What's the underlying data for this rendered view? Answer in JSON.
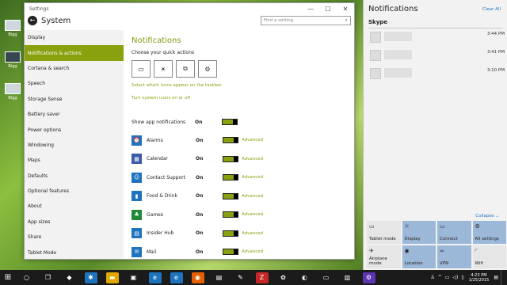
{
  "desktop": {
    "icons": [
      {
        "label": "Bigg",
        "icon": "thumbnail"
      },
      {
        "label": "Bigg",
        "icon": "thumbnail-dark"
      },
      {
        "label": "Bigg",
        "icon": "thumbnail"
      }
    ]
  },
  "window": {
    "title": "Settings",
    "controls": {
      "minimize": "—",
      "maximize": "☐",
      "close": "✕"
    },
    "header_title": "System",
    "search_placeholder": "Find a setting"
  },
  "sidebar": {
    "items": [
      {
        "label": "Display"
      },
      {
        "label": "Notifications & actions",
        "active": true
      },
      {
        "label": "Cortana & search"
      },
      {
        "label": "Speech"
      },
      {
        "label": "Storage Sense"
      },
      {
        "label": "Battery saver"
      },
      {
        "label": "Power options"
      },
      {
        "label": "Windowing"
      },
      {
        "label": "Maps"
      },
      {
        "label": "Defaults"
      },
      {
        "label": "Optional features"
      },
      {
        "label": "About"
      },
      {
        "label": "App sizes"
      },
      {
        "label": "Share"
      },
      {
        "label": "Tablet Mode"
      }
    ]
  },
  "content": {
    "heading": "Notifications",
    "quick_actions_label": "Choose your quick actions",
    "quick_actions": [
      {
        "icon": "tablet-icon",
        "glyph": "▭"
      },
      {
        "icon": "brightness-icon",
        "glyph": "☀"
      },
      {
        "icon": "connect-icon",
        "glyph": "⧉"
      },
      {
        "icon": "settings-icon",
        "glyph": "⚙"
      }
    ],
    "link_taskbar": "Select which icons appear on the taskbar",
    "link_system_icons": "Turn system icons on or off",
    "show_app_notifications": "Show app notifications",
    "on_label": "On",
    "advanced_label": "Advanced",
    "apps": [
      {
        "name": "Alarms",
        "color": "#1e73be",
        "glyph": "⏰"
      },
      {
        "name": "Calendar",
        "color": "#3a5ba8",
        "glyph": "▦"
      },
      {
        "name": "Contact Support",
        "color": "#1e73be",
        "glyph": "☺"
      },
      {
        "name": "Food & Drink",
        "color": "#1e73be",
        "glyph": "▮"
      },
      {
        "name": "Games",
        "color": "#1e8a3a",
        "glyph": "♣"
      },
      {
        "name": "Insider Hub",
        "color": "#1e73be",
        "glyph": "▤"
      },
      {
        "name": "Mail",
        "color": "#1e73be",
        "glyph": "✉"
      }
    ]
  },
  "action_center": {
    "title": "Notifications",
    "clear_all": "Clear All",
    "app_group": "Skype",
    "notifications": [
      {
        "time": "3:44 PM"
      },
      {
        "time": "3:41 PM"
      },
      {
        "time": "3:10 PM"
      }
    ],
    "collapse": "Collapse ⌄",
    "tiles": [
      {
        "label": "Tablet mode",
        "glyph": "▭",
        "on": false
      },
      {
        "label": "Display",
        "glyph": "☼",
        "on": true
      },
      {
        "label": "Connect",
        "glyph": "▭",
        "on": true
      },
      {
        "label": "All settings",
        "glyph": "⚙",
        "on": true
      },
      {
        "label": "Airplane mode",
        "glyph": "✈",
        "on": false
      },
      {
        "label": "Location",
        "glyph": "◉",
        "on": true
      },
      {
        "label": "VPN",
        "glyph": "∞",
        "on": true
      },
      {
        "label": "Wifi",
        "glyph": "◜",
        "on": false
      }
    ]
  },
  "taskbar": {
    "start_glyph": "⊞",
    "icons": [
      {
        "name": "search-icon",
        "glyph": "○",
        "color": "#1b1b1b"
      },
      {
        "name": "task-view-icon",
        "glyph": "❐",
        "color": "#1b1b1b"
      },
      {
        "name": "app-icon-1",
        "glyph": "◆",
        "color": "#1b1b1b"
      },
      {
        "name": "app-icon-2",
        "glyph": "✱",
        "color": "#1e73be"
      },
      {
        "name": "app-icon-3",
        "glyph": "▬",
        "color": "#e0a800"
      },
      {
        "name": "app-icon-4",
        "glyph": "▣",
        "color": "#1b1b1b"
      },
      {
        "name": "edge-icon",
        "glyph": "e",
        "color": "#1e73be"
      },
      {
        "name": "ie-icon",
        "glyph": "e",
        "color": "#1e73be"
      },
      {
        "name": "firefox-icon",
        "glyph": "◉",
        "color": "#e66000"
      },
      {
        "name": "store-icon",
        "glyph": "▤",
        "color": "#1b1b1b"
      },
      {
        "name": "app-icon-5",
        "glyph": "✎",
        "color": "#1b1b1b"
      },
      {
        "name": "filezilla-icon",
        "glyph": "Z",
        "color": "#c62828"
      },
      {
        "name": "app-icon-6",
        "glyph": "✿",
        "color": "#1b1b1b"
      },
      {
        "name": "app-icon-7",
        "glyph": "◐",
        "color": "#1b1b1b"
      },
      {
        "name": "app-icon-8",
        "glyph": "▭",
        "color": "#1b1b1b"
      },
      {
        "name": "app-icon-9",
        "glyph": "▥",
        "color": "#1b1b1b"
      },
      {
        "name": "settings-taskbar-icon",
        "glyph": "⚙",
        "color": "#5e35b1"
      }
    ],
    "tray": [
      "♙",
      "^",
      "▭",
      "◁)",
      "▯"
    ],
    "time": "4:23 PM",
    "date": "1/25/2015"
  }
}
